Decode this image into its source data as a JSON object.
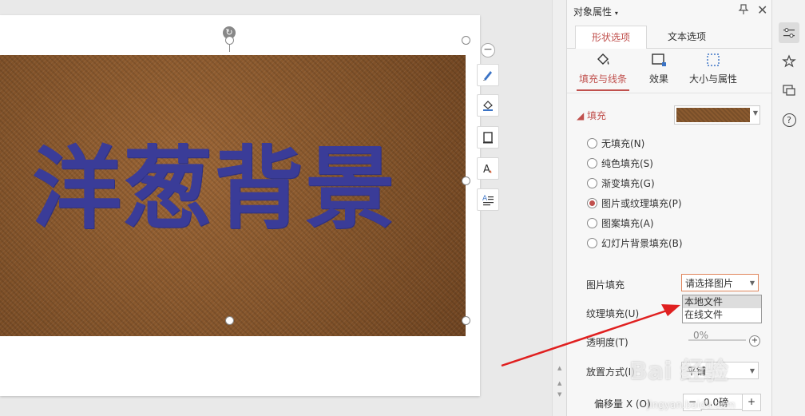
{
  "slide": {
    "title_text": "洋葱背景",
    "rotate_icon": "rotate-icon"
  },
  "colors": {
    "accent": "#c0504d",
    "slide_text": "#3a3c98",
    "leather": "#8a5a2f",
    "annotation_arrow": "#e02020"
  },
  "panel": {
    "title": "对象属性",
    "title_caret": "▾",
    "pin_icon": "pin-icon",
    "close_icon": "close-icon",
    "tabs": [
      {
        "label": "形状选项",
        "active": true
      },
      {
        "label": "文本选项",
        "active": false
      }
    ],
    "subtabs": [
      {
        "label": "填充与线条",
        "icon": "paint-bucket-icon",
        "active": true
      },
      {
        "label": "效果",
        "icon": "effect-icon",
        "active": false
      },
      {
        "label": "大小与属性",
        "icon": "size-icon",
        "active": false
      }
    ],
    "fill_section": {
      "header": "填充",
      "options": [
        {
          "label": "无填充(N)",
          "checked": false
        },
        {
          "label": "纯色填充(S)",
          "checked": false
        },
        {
          "label": "渐变填充(G)",
          "checked": false
        },
        {
          "label": "图片或纹理填充(P)",
          "checked": true
        },
        {
          "label": "图案填充(A)",
          "checked": false
        },
        {
          "label": "幻灯片背景填充(B)",
          "checked": false
        }
      ]
    },
    "picture_fill": {
      "label": "图片填充",
      "select_value": "请选择图片",
      "dropdown_options": [
        "本地文件",
        "在线文件"
      ]
    },
    "texture_fill": {
      "label": "纹理填充(U)"
    },
    "transparency": {
      "label": "透明度(T)",
      "value": "0%"
    },
    "placement": {
      "label": "放置方式(I)",
      "value": "平铺"
    },
    "offset_x": {
      "label": "偏移量 X (O)",
      "value": "0.0磅",
      "minus": "−",
      "plus": "+"
    }
  },
  "float_toolbar": {
    "minus": "−",
    "tools": [
      "brush-icon",
      "fill-icon",
      "outline-icon",
      "text-style-icon",
      "text-wrap-icon"
    ]
  },
  "right_strip": {
    "help": "?"
  },
  "watermark": {
    "brand": "Bai 经验",
    "url": "jingyan.baidu.com"
  }
}
